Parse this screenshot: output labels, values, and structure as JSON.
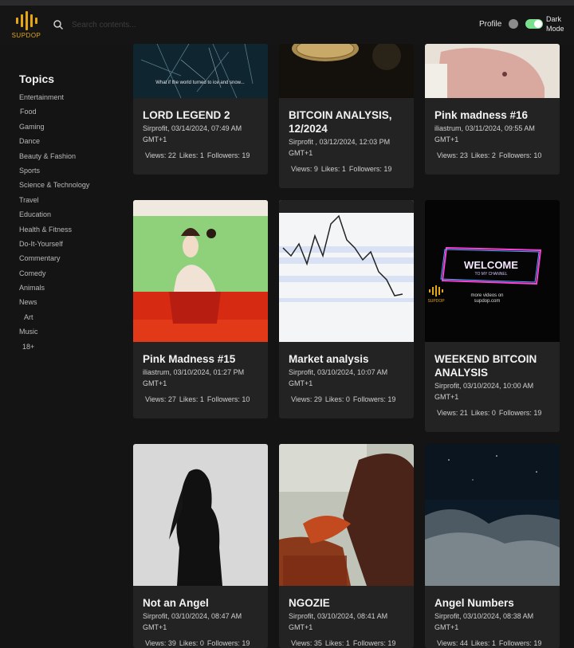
{
  "header": {
    "brand": "SUPDOP",
    "search_placeholder": "Search contents...",
    "profile_label": "Profile",
    "dark_mode_label": "Dark Mode",
    "dark_mode_on": true,
    "accent": "#e6a614",
    "toggle_color": "#7be08d"
  },
  "sidebar": {
    "title": "Topics",
    "topics": [
      "Entertainment",
      "Food",
      "Gaming",
      "Dance",
      "Beauty & Fashion",
      "Sports",
      "Science & Technology",
      "Travel",
      "Education",
      "Health & Fitness",
      "Do-It-Yourself",
      "Commentary",
      "Comedy",
      "Animals",
      "News",
      "Art",
      "Music",
      "18+"
    ]
  },
  "cards": [
    {
      "title": "LORD LEGEND 2",
      "meta": "Sirprofit, 03/14/2024, 07:49 AM GMT+1",
      "views": "Views: 22",
      "likes": "Likes: 1",
      "followers": "Followers: 19",
      "thumb_caption": "What if the world turned to ice and snow..."
    },
    {
      "title": "BITCOIN ANALYSIS, 12/2024",
      "meta": "Sirprofit , 03/12/2024, 12:03 PM GMT+1",
      "views": "Views: 9",
      "likes": "Likes: 1",
      "followers": "Followers: 19"
    },
    {
      "title": "Pink madness #16",
      "meta": "iliastrum, 03/11/2024, 09:55 AM GMT+1",
      "views": "Views: 23",
      "likes": "Likes: 2",
      "followers": "Followers: 10"
    },
    {
      "title": "Pink Madness #15",
      "meta": "iliastrum, 03/10/2024, 01:27 PM GMT+1",
      "views": "Views: 27",
      "likes": "Likes: 1",
      "followers": "Followers: 10"
    },
    {
      "title": "Market analysis",
      "meta": "Sirprofit, 03/10/2024, 10:07 AM GMT+1",
      "views": "Views: 29",
      "likes": "Likes: 0",
      "followers": "Followers: 19"
    },
    {
      "title": "WEEKEND BITCOIN ANALYSIS",
      "meta": "Sirprofit, 03/10/2024, 10:00 AM GMT+1",
      "views": "Views: 21",
      "likes": "Likes: 0",
      "followers": "Followers: 19",
      "thumb_heading": "WELCOME",
      "thumb_sub": "TO MY CHANNEL",
      "thumb_brand": "SUPDOP",
      "thumb_more": "more videos on",
      "thumb_url": "supdop.com"
    },
    {
      "title": "Not an Angel",
      "meta": "Sirprofit, 03/10/2024, 08:47 AM GMT+1",
      "views": "Views: 39",
      "likes": "Likes: 0",
      "followers": "Followers: 19"
    },
    {
      "title": "NGOZIE",
      "meta": "Sirprofit, 03/10/2024, 08:41 AM GMT+1",
      "views": "Views: 35",
      "likes": "Likes: 1",
      "followers": "Followers: 19"
    },
    {
      "title": "Angel Numbers",
      "meta": "Sirprofit, 03/10/2024, 08:38 AM GMT+1",
      "views": "Views: 44",
      "likes": "Likes: 1",
      "followers": "Followers: 19"
    }
  ]
}
